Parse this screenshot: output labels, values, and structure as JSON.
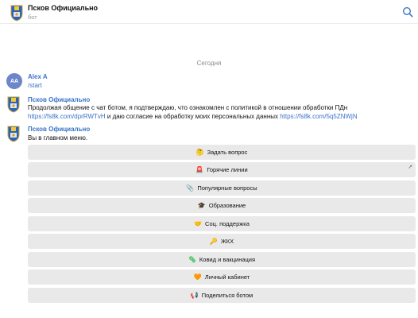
{
  "header": {
    "title": "Псков Официально",
    "subtitle": "бот",
    "avatar_icon": "pskov-coat-of-arms",
    "search_icon": "search-icon"
  },
  "date_separator": "Сегодня",
  "messages": [
    {
      "sender": "Alex A",
      "avatar_initials": "AA",
      "avatar_color": "#6b86c9",
      "text": "/start"
    },
    {
      "sender": "Псков Официально",
      "text_before": "Продолжая общение с чат ботом, я подтверждаю, что ознакомлен с политикой в отношении обработки ПДн ",
      "link1": "https://fs8k.com/dprRWTvH",
      "text_middle": " и даю согласие на обработку моих персональных данных ",
      "link2": "https://fs8k.com/5q5ZNWjN"
    },
    {
      "sender": "Псков Официально",
      "text": "Вы в главном меню."
    }
  ],
  "keyboard": [
    {
      "emoji": "🤔",
      "label": "Задать вопрос"
    },
    {
      "emoji": "🚨",
      "label": "Горячие линии",
      "corner": "↗"
    },
    {
      "emoji": "📎",
      "label": "Популярные вопросы"
    },
    {
      "emoji": "🎓",
      "label": "Образование"
    },
    {
      "emoji": "🤝",
      "label": "Соц. поддержка"
    },
    {
      "emoji": "🔑",
      "label": "ЖКХ"
    },
    {
      "emoji": "🦠",
      "label": "Ковид и вакцинация"
    },
    {
      "emoji": "🧡",
      "label": "Личный кабинет"
    },
    {
      "emoji": "📢",
      "label": "Поделиться ботом"
    }
  ],
  "colors": {
    "accent": "#3b73c6",
    "button_bg": "#e9e9e9",
    "muted": "#8a8a8a"
  }
}
